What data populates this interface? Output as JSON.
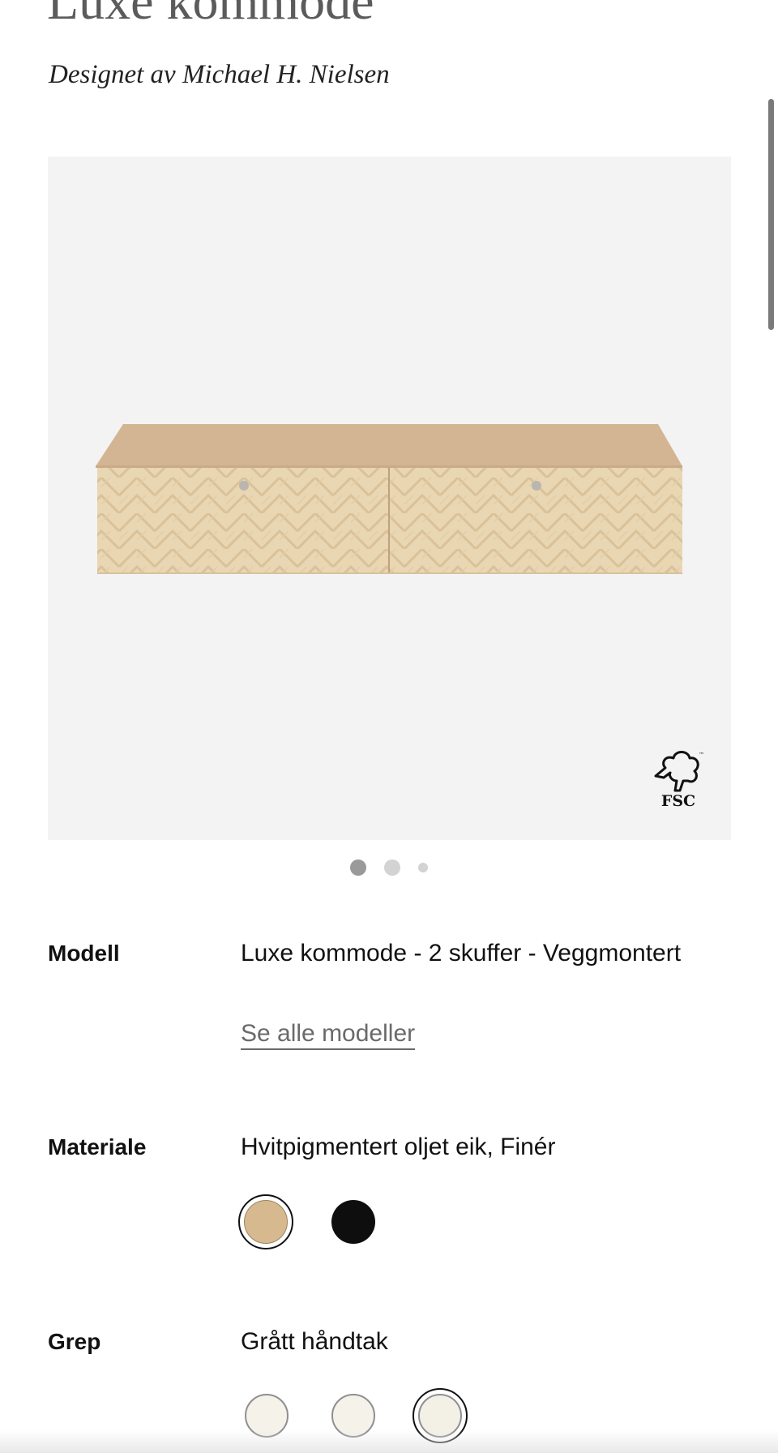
{
  "product": {
    "title": "Luxe kommode",
    "designer": "Designet av Michael H. Nielsen"
  },
  "gallery": {
    "badge_text": "FSC",
    "badge_tm": "™",
    "slide_count": 3,
    "active_slide": 1
  },
  "specs": {
    "model": {
      "label": "Modell",
      "value": "Luxe kommode - 2 skuffer - Veggmontert",
      "link": "Se alle modeller"
    },
    "material": {
      "label": "Materiale",
      "value": "Hvitpigmentert oljet eik, Finér",
      "options": [
        {
          "name": "oak-swatch",
          "color": "#d6b98f",
          "selected": true
        },
        {
          "name": "black-swatch",
          "color": "#0e0e0e",
          "selected": false
        }
      ]
    },
    "grip": {
      "label": "Grep",
      "value": "Grått håndtak",
      "options": [
        {
          "name": "handle-swatch-1",
          "color": "#f5f2ea",
          "selected": false
        },
        {
          "name": "handle-swatch-2",
          "color": "#f5f2ea",
          "selected": false
        },
        {
          "name": "handle-swatch-3",
          "color": "#f3f0e6",
          "selected": true
        }
      ]
    }
  },
  "colors": {
    "title": "#5b5b5b",
    "gallery_bg": "#f3f3f3",
    "link": "#6a6a6a"
  }
}
